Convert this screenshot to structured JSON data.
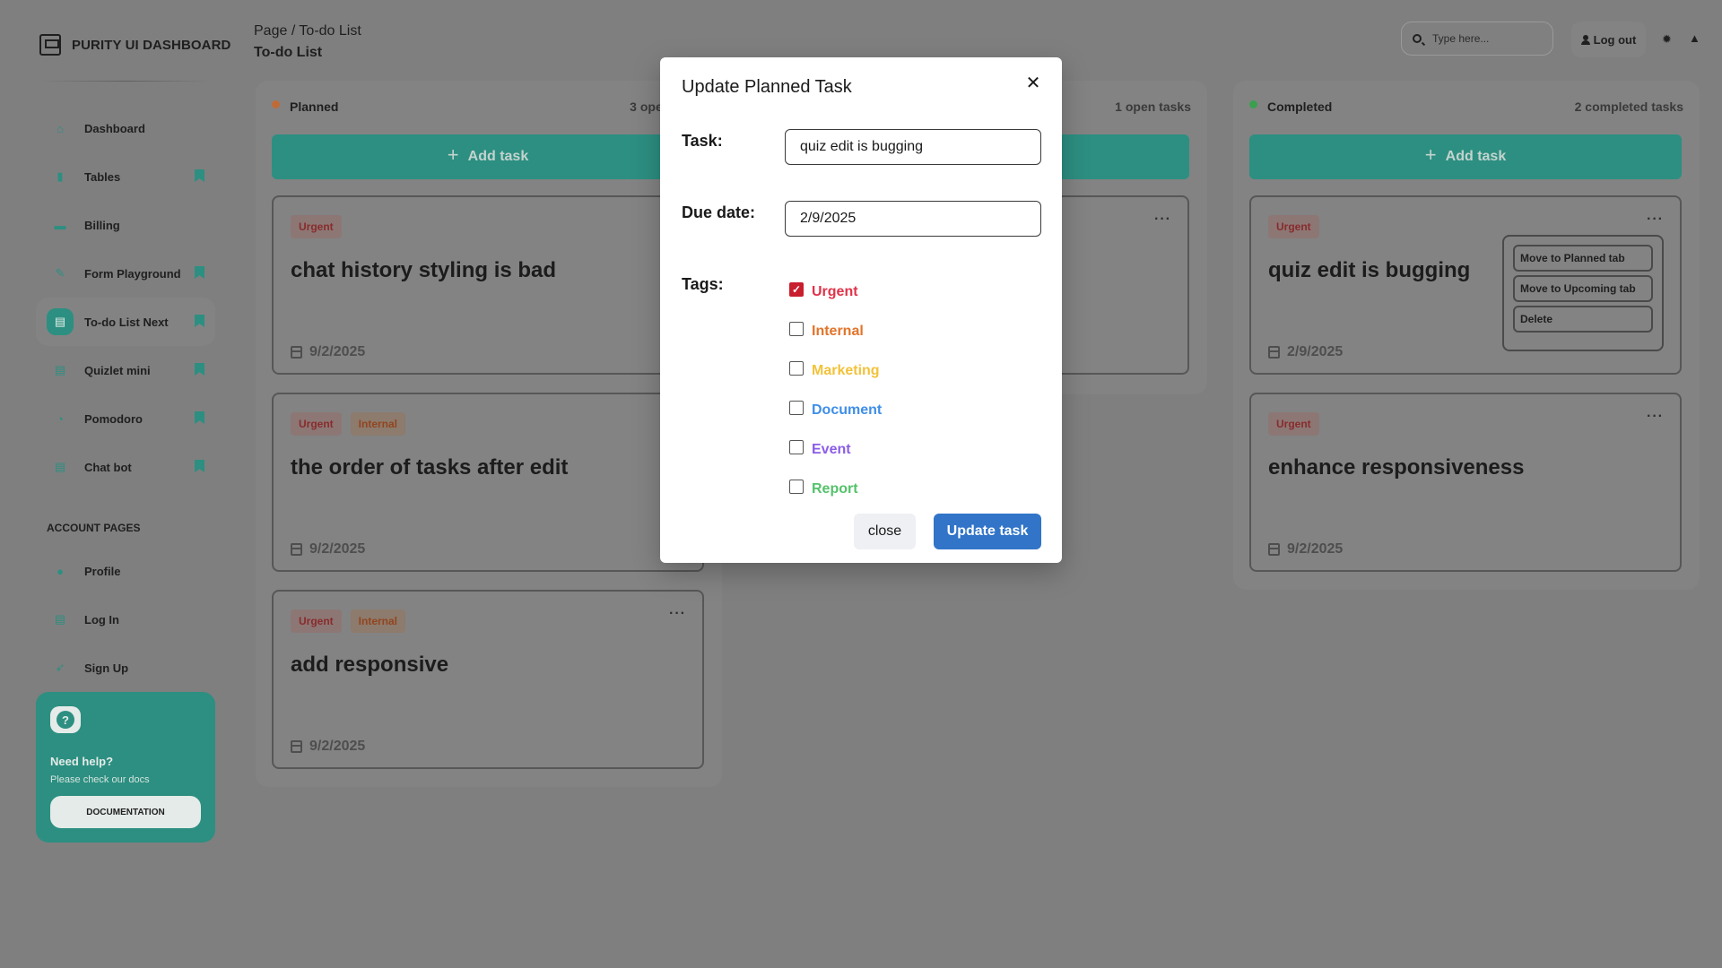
{
  "brand": {
    "title": "PURITY UI DASHBOARD"
  },
  "sidebar": {
    "items": [
      {
        "label": "Dashboard",
        "icon": "home-icon",
        "glyph": "⌂"
      },
      {
        "label": "Tables",
        "icon": "bar-chart-icon",
        "glyph": "▮"
      },
      {
        "label": "Billing",
        "icon": "credit-card-icon",
        "glyph": "▬"
      },
      {
        "label": "Form Playground",
        "icon": "wrench-icon",
        "glyph": "✎"
      },
      {
        "label": "To-do List Next",
        "icon": "document-icon",
        "glyph": "▤"
      },
      {
        "label": "Quizlet mini",
        "icon": "document-icon",
        "glyph": "▤"
      },
      {
        "label": "Pomodoro",
        "icon": "clock-icon",
        "glyph": "◔"
      },
      {
        "label": "Chat bot",
        "icon": "document-icon",
        "glyph": "▤"
      }
    ],
    "account_title": "ACCOUNT PAGES",
    "account_items": [
      {
        "label": "Profile",
        "icon": "person-icon",
        "glyph": "●"
      },
      {
        "label": "Log In",
        "icon": "file-icon",
        "glyph": "▤"
      },
      {
        "label": "Sign Up",
        "icon": "rocket-icon",
        "glyph": "➶"
      }
    ],
    "help": {
      "title": "Need help?",
      "subtitle": "Please check our docs",
      "button": "DOCUMENTATION",
      "icon_glyph": "?"
    }
  },
  "header": {
    "breadcrumb": "Page / To-do List",
    "title": "To-do List",
    "search_placeholder": "Type here...",
    "logout_label": "Log out"
  },
  "columns": {
    "planned": {
      "name": "Planned",
      "count": "3 open tasks",
      "add_label": "Add task",
      "cards": [
        {
          "tags": [
            "Urgent"
          ],
          "title": "chat history styling is bad",
          "date": "9/2/2025"
        },
        {
          "tags": [
            "Urgent",
            "Internal"
          ],
          "title": "the order of tasks after edit",
          "date": "9/2/2025"
        },
        {
          "tags": [
            "Urgent",
            "Internal"
          ],
          "title": "add responsive",
          "date": "9/2/2025",
          "menu": "···"
        }
      ]
    },
    "upcoming": {
      "count": "1 open tasks",
      "menu": "···"
    },
    "completed": {
      "name": "Completed",
      "count": "2 completed tasks",
      "add_label": "Add task",
      "cards": [
        {
          "tags": [
            "Urgent"
          ],
          "title": "quiz edit is bugging",
          "date": "2/9/2025",
          "menu": "···"
        },
        {
          "tags": [
            "Urgent"
          ],
          "title": "enhance responsiveness",
          "date": "9/2/2025",
          "menu": "···"
        }
      ],
      "popover": [
        "Move to Planned tab",
        "Move to Upcoming tab",
        "Delete"
      ]
    }
  },
  "modal": {
    "title": "Update Planned Task",
    "task_label": "Task:",
    "task_value": "quiz edit is bugging",
    "due_label": "Due date:",
    "due_value": "2/9/2025",
    "tags_label": "Tags:",
    "tags": [
      {
        "label": "Urgent",
        "checked": true,
        "color": "#e0334a"
      },
      {
        "label": "Internal",
        "checked": false,
        "color": "#e2742b"
      },
      {
        "label": "Marketing",
        "checked": false,
        "color": "#f2c23a"
      },
      {
        "label": "Document",
        "checked": false,
        "color": "#3f8ee8"
      },
      {
        "label": "Event",
        "checked": false,
        "color": "#8b5de6"
      },
      {
        "label": "Report",
        "checked": false,
        "color": "#54c26a"
      }
    ],
    "close_label": "close",
    "update_label": "Update task"
  },
  "colors": {
    "accent": "#2c8f81",
    "overlay": "#7f7f7f",
    "primary_button": "#3174c8",
    "planned_dot": "#c06b37",
    "completed_dot": "#3aa04f"
  }
}
